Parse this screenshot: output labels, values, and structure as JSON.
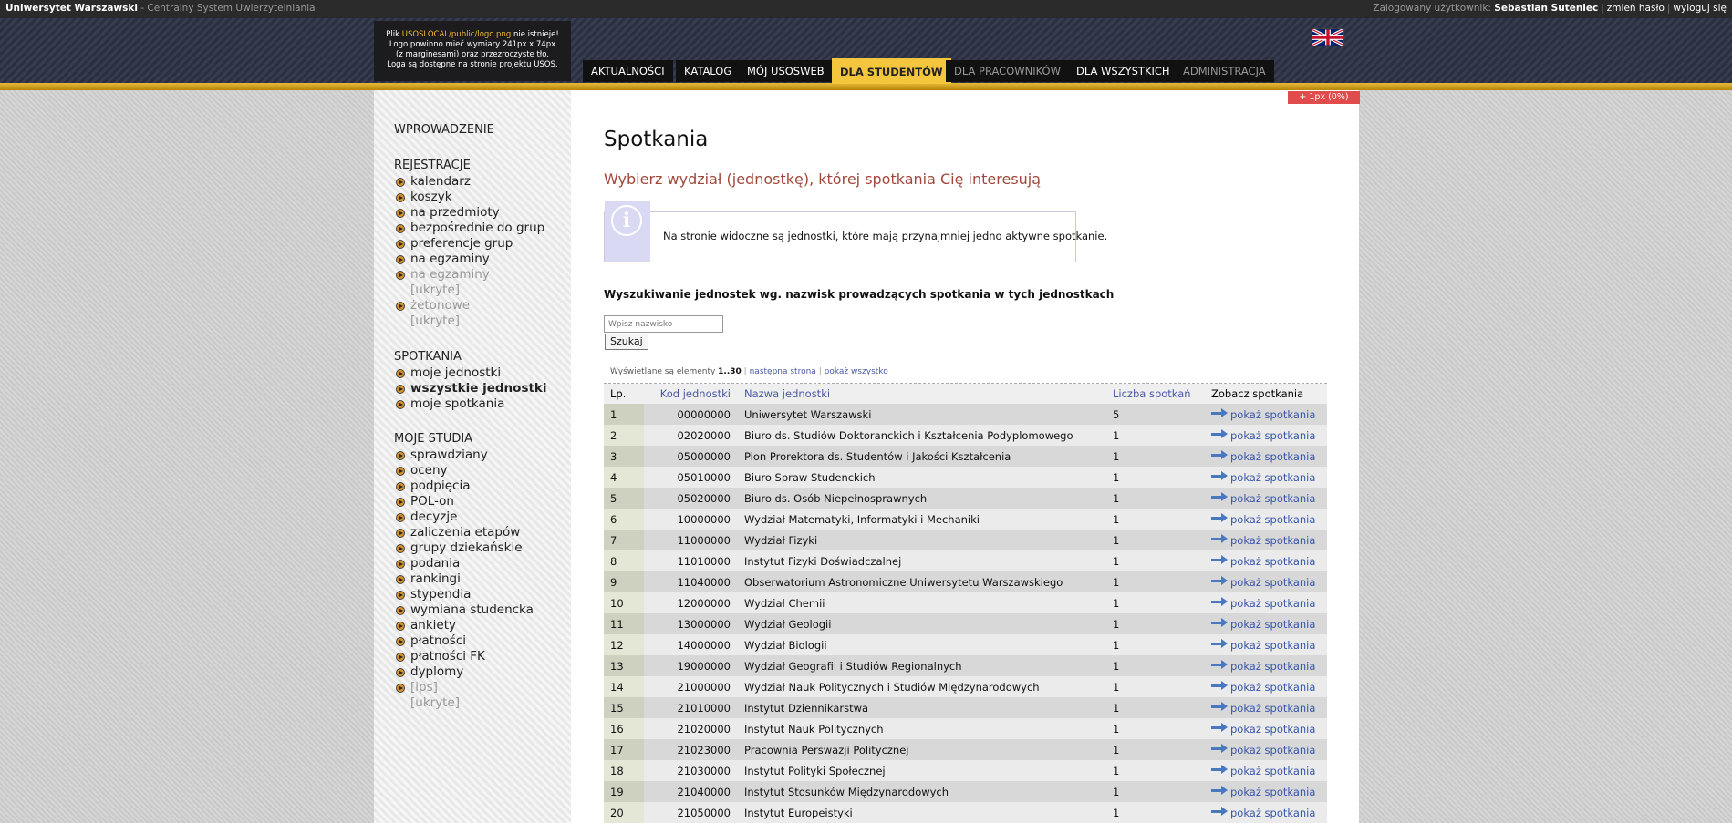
{
  "topbar": {
    "site_name": "Uniwersytet Warszawski",
    "site_sub": " - Centralny System Uwierzytelniania",
    "logged_label": "Zalogowany użytkownik: ",
    "user": "Sebastian Suteniec",
    "change_password": "zmień hasło",
    "logout": "wyloguj się"
  },
  "logo_box": {
    "line1_pre": "Plik ",
    "line1_path": "USOSLOCAL/public/logo.png",
    "line1_post": " nie istnieje!",
    "line2": "Logo powinno mieć wymiary 241px x 74px",
    "line3": "(z marginesami) oraz przezroczyste tło.",
    "line4": "Loga są dostępne na stronie projektu USOS."
  },
  "nav": {
    "tabs": [
      {
        "label": "AKTUALNOŚCI"
      },
      {
        "label": "KATALOG"
      },
      {
        "label": "MÓJ USOSWEB"
      },
      {
        "label": "DLA STUDENTÓW"
      },
      {
        "label": "DLA PRACOWNIKÓW"
      },
      {
        "label": "DLA WSZYSTKICH"
      },
      {
        "label": "ADMINISTRACJA"
      }
    ]
  },
  "progress_badge": "+ 1px (0%)",
  "sidebar": {
    "intro": "WPROWADZENIE",
    "rejestracje_title": "REJESTRACJE",
    "rejestracje": [
      "kalendarz",
      "koszyk",
      "na przedmioty",
      "bezpośrednie do grup",
      "preferencje grup",
      "na egzaminy",
      "na egzaminy",
      "[ukryte]",
      "żetonowe",
      "[ukryte]"
    ],
    "spotkania_title": "SPOTKANIA",
    "spotkania": [
      "moje jednostki",
      "wszystkie jednostki",
      "moje spotkania"
    ],
    "studia_title": "MOJE STUDIA",
    "studia": [
      "sprawdziany",
      "oceny",
      "podpięcia",
      "POL-on",
      "decyzje",
      "zaliczenia etapów",
      "grupy dziekańskie",
      "podania",
      "rankingi",
      "stypendia",
      "wymiana studencka",
      "ankiety",
      "płatności",
      "płatności FK",
      "dyplomy",
      "[ips]",
      "[ukryte]"
    ]
  },
  "main": {
    "title": "Spotkania",
    "subtitle": "Wybierz wydział (jednostkę), której spotkania Cię interesują",
    "info_text": "Na stronie widoczne są jednostki, które mają przynajmniej jedno aktywne spotkanie.",
    "search_heading": "Wyszukiwanie jednostek wg. nazwisk prowadzących spotkania w tych jednostkach",
    "search_placeholder": "Wpisz nazwisko",
    "search_button": "Szukaj",
    "pager": {
      "prefix": "Wyświetlane są elementy ",
      "range": "1..30",
      "next": "następna strona",
      "all": "pokaż wszystko"
    }
  },
  "table": {
    "headers": {
      "lp": "Lp.",
      "kod": "Kod jednostki",
      "name": "Nazwa jednostki",
      "count": "Liczba spotkań",
      "see": "Zobacz spotkania"
    },
    "link_label": "pokaż spotkania",
    "rows": [
      {
        "lp": "1",
        "kod": "00000000",
        "name": "Uniwersytet Warszawski",
        "count": "5"
      },
      {
        "lp": "2",
        "kod": "02020000",
        "name": "Biuro ds. Studiów Doktoranckich i Kształcenia Podyplomowego",
        "count": "1"
      },
      {
        "lp": "3",
        "kod": "05000000",
        "name": "Pion Prorektora ds. Studentów i Jakości Kształcenia",
        "count": "1"
      },
      {
        "lp": "4",
        "kod": "05010000",
        "name": "Biuro Spraw Studenckich",
        "count": "1"
      },
      {
        "lp": "5",
        "kod": "05020000",
        "name": "Biuro ds. Osób Niepełnosprawnych",
        "count": "1"
      },
      {
        "lp": "6",
        "kod": "10000000",
        "name": "Wydział Matematyki, Informatyki i Mechaniki",
        "count": "1"
      },
      {
        "lp": "7",
        "kod": "11000000",
        "name": "Wydział Fizyki",
        "count": "1"
      },
      {
        "lp": "8",
        "kod": "11010000",
        "name": "Instytut Fizyki Doświadczalnej",
        "count": "1"
      },
      {
        "lp": "9",
        "kod": "11040000",
        "name": "Obserwatorium Astronomiczne Uniwersytetu Warszawskiego",
        "count": "1"
      },
      {
        "lp": "10",
        "kod": "12000000",
        "name": "Wydział Chemii",
        "count": "1"
      },
      {
        "lp": "11",
        "kod": "13000000",
        "name": "Wydział Geologii",
        "count": "1"
      },
      {
        "lp": "12",
        "kod": "14000000",
        "name": "Wydział Biologii",
        "count": "1"
      },
      {
        "lp": "13",
        "kod": "19000000",
        "name": "Wydział Geografii i Studiów Regionalnych",
        "count": "1"
      },
      {
        "lp": "14",
        "kod": "21000000",
        "name": "Wydział Nauk Politycznych i Studiów Międzynarodowych",
        "count": "1"
      },
      {
        "lp": "15",
        "kod": "21010000",
        "name": "Instytut Dziennikarstwa",
        "count": "1"
      },
      {
        "lp": "16",
        "kod": "21020000",
        "name": "Instytut Nauk Politycznych",
        "count": "1"
      },
      {
        "lp": "17",
        "kod": "21023000",
        "name": "Pracownia Perswazji Politycznej",
        "count": "1"
      },
      {
        "lp": "18",
        "kod": "21030000",
        "name": "Instytut Polityki Społecznej",
        "count": "1"
      },
      {
        "lp": "19",
        "kod": "21040000",
        "name": "Instytut Stosunków Międzynarodowych",
        "count": "1"
      },
      {
        "lp": "20",
        "kod": "21050000",
        "name": "Instytut Europeistyki",
        "count": "1"
      }
    ]
  }
}
